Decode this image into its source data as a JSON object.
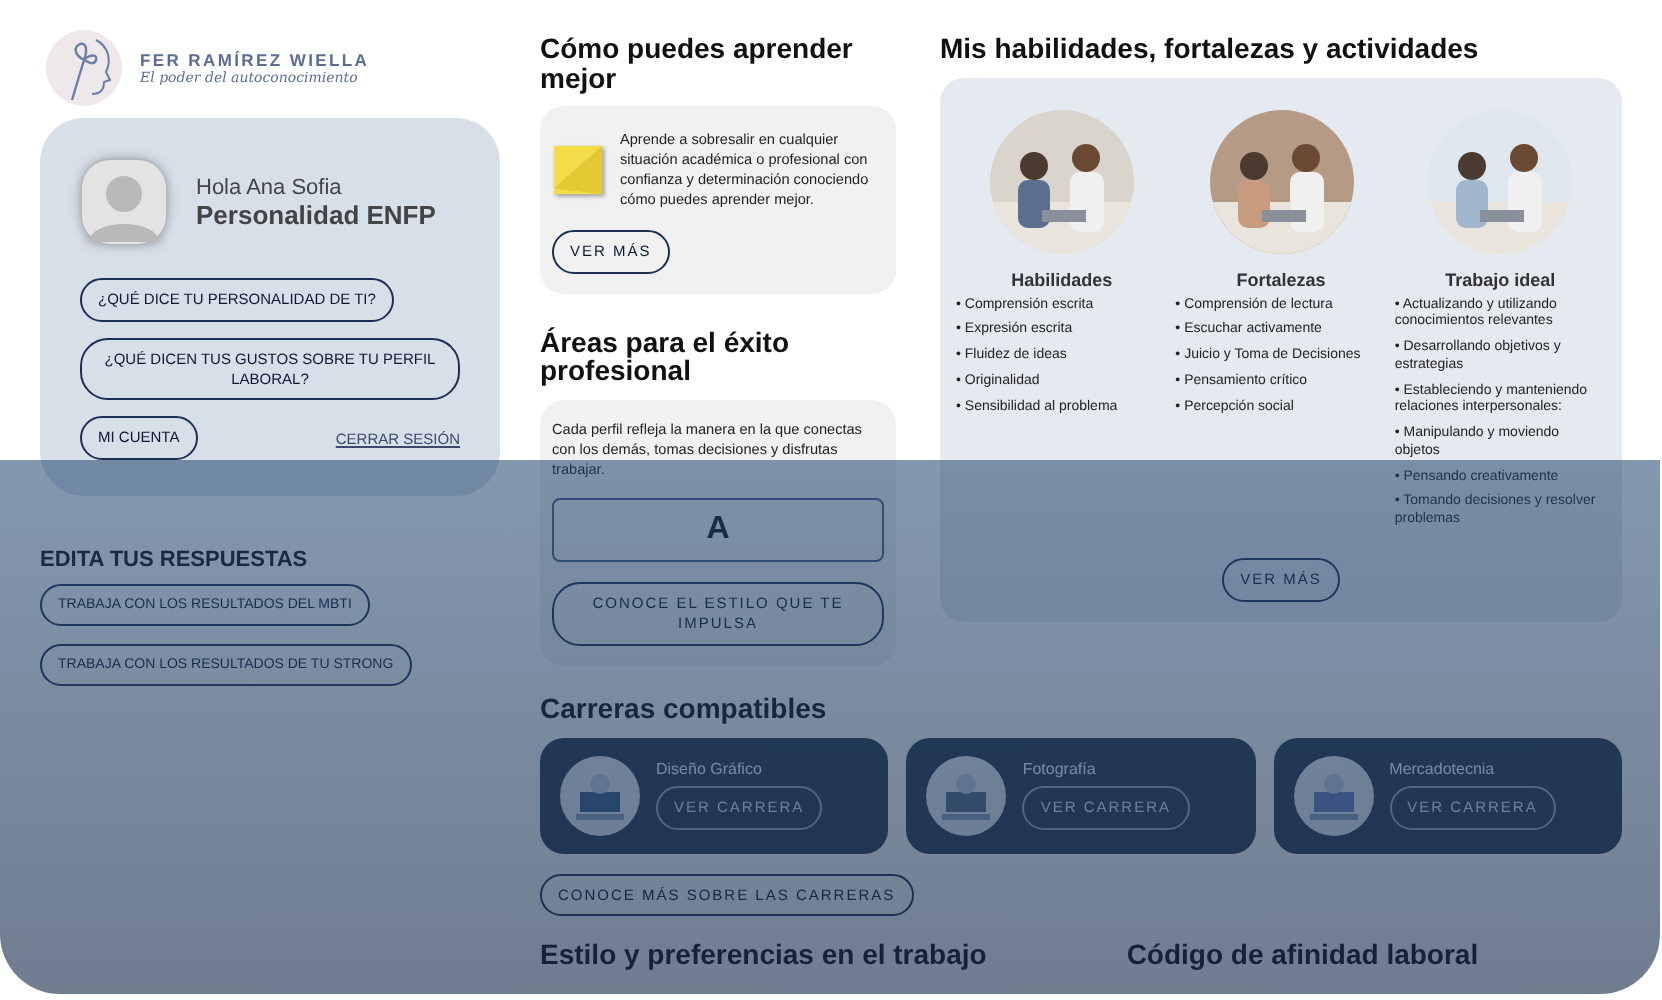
{
  "brand": {
    "name": "FER RAMÍREZ WIELLA",
    "tagline": "El poder del autoconocimiento"
  },
  "profile": {
    "greeting": "Hola Ana Sofia",
    "title": "Personalidad ENFP",
    "buttons": [
      "¿QUÉ DICE TU PERSONALIDAD DE TI?",
      "¿QUÉ DICEN TUS GUSTOS SOBRE TU PERFIL LABORAL?"
    ],
    "account_button": "MI CUENTA",
    "logout_link": "CERRAR SESIÓN"
  },
  "edit": {
    "title": "EDITA TUS RESPUESTAS",
    "buttons": [
      "TRABAJA CON LOS RESULTADOS DEL MBTI",
      "TRABAJA CON LOS RESULTADOS DE TU STRONG"
    ]
  },
  "learning": {
    "title": "Cómo puedes aprender mejor",
    "text": "Aprende a sobresalir en cualquier situación académica o profesional con confianza y determinación conociendo cómo puedes aprender mejor.",
    "button": "VER MÁS"
  },
  "areas": {
    "title": "Áreas para el éxito profesional",
    "text": "Cada perfil refleja la manera en la que conectas con los demás, tomas decisiones y disfrutas trabajar.",
    "letter": "A",
    "button": "CONOCE EL ESTILO QUE TE IMPULSA"
  },
  "skills": {
    "title": "Mis habilidades, fortalezas y actividades",
    "columns": [
      {
        "title": "Habilidades",
        "items": [
          "• Comprensión escrita",
          "• Expresión escrita",
          "• Fluidez de ideas",
          "• Originalidad",
          "• Sensibilidad al problema"
        ]
      },
      {
        "title": "Fortalezas",
        "items": [
          "• Comprensión de lectura",
          "• Escuchar activamente",
          "• Juicio y Toma de Decisiones",
          "• Pensamiento crítico",
          "• Percepción social"
        ]
      },
      {
        "title": "Trabajo ideal",
        "items": [
          "• Actualizando y utilizando conocimientos relevantes",
          "• Desarrollando objetivos y estrategias",
          "• Estableciendo y manteniendo relaciones interpersonales:",
          "• Manipulando y moviendo objetos",
          "• Pensando creativamente",
          "• Tomando decisiones y resolver problemas"
        ]
      }
    ],
    "button": "VER MÁS"
  },
  "careers": {
    "title": "Carreras compatibles",
    "items": [
      {
        "name": "Diseño Gráfico",
        "button": "VER CARRERA"
      },
      {
        "name": "Fotografía",
        "button": "VER CARRERA"
      },
      {
        "name": "Mercadotecnia",
        "button": "VER CARRERA"
      }
    ],
    "more_button": "CONOCE MÁS SOBRE LAS CARRERAS"
  },
  "bottom_headings": [
    "Estilo y preferencias en el trabajo",
    "Código de afinidad laboral"
  ]
}
